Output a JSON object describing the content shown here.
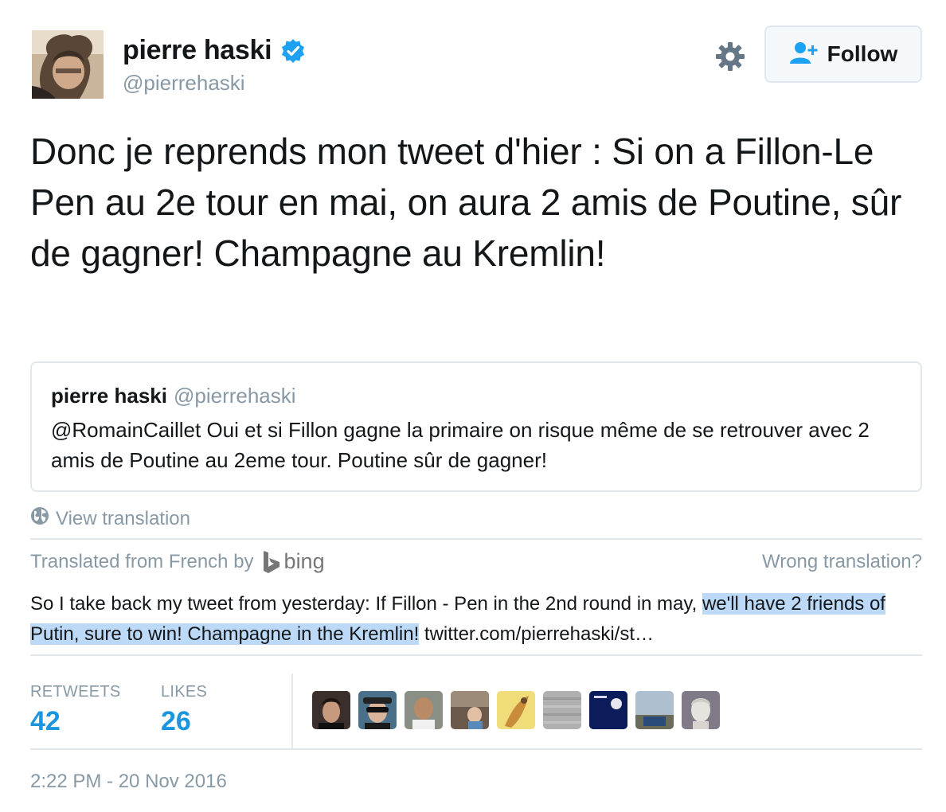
{
  "author": {
    "display_name": "pierre haski",
    "handle": "@pierrehaski",
    "verified": true,
    "avatar_icon": "author-photo"
  },
  "actions": {
    "settings_icon": "gear-icon",
    "follow_label": "Follow",
    "follow_icon": "add-user-icon"
  },
  "tweet": {
    "text": "Donc je reprends mon tweet d'hier : Si on a Fillon-Le Pen au 2e tour en mai, on aura 2 amis de Poutine, sûr de gagner! Champagne au Kremlin!"
  },
  "quoted_tweet": {
    "display_name": "pierre haski",
    "handle": "@pierrehaski",
    "text": "@RomainCaillet Oui et si Fillon gagne la primaire on risque même de se retrouver avec 2 amis de Poutine au 2eme tour. Poutine sûr de gagner!"
  },
  "translation": {
    "view_label": "View translation",
    "translated_from": "Translated from French by",
    "provider": "bing",
    "wrong_label": "Wrong translation?",
    "text_plain": "So I take back my tweet from yesterday: If Fillon - Pen in the 2nd round in may, ",
    "text_highlighted": "we'll have 2 friends of Putin, sure to win! Champagne in the Kremlin!",
    "text_link": " twitter.com/pierrehaski/st…"
  },
  "stats": {
    "retweets_label": "RETWEETS",
    "retweets_value": "42",
    "likes_label": "LIKES",
    "likes_value": "26"
  },
  "likers_count_shown": 9,
  "timestamp": "2:22 PM - 20 Nov 2016",
  "colors": {
    "accent": "#1b95e0",
    "muted": "#8899a6",
    "border": "#e1e8ed",
    "highlight": "#bcdaf7"
  }
}
